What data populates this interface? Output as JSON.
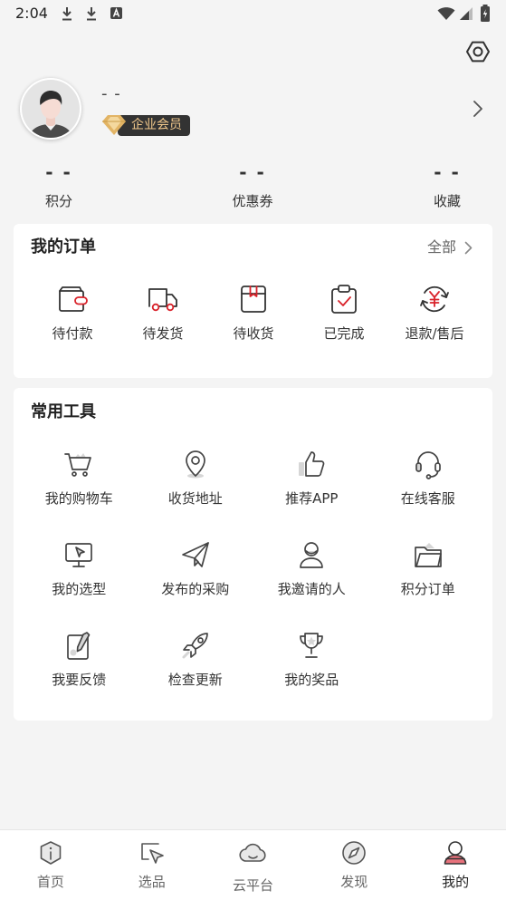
{
  "status_bar": {
    "time": "2:04",
    "left_icons": [
      "download-icon",
      "download-icon",
      "a-badge-icon"
    ],
    "right_icons": [
      "wifi-icon",
      "signal-icon",
      "battery-icon"
    ]
  },
  "header": {
    "settings_icon": "settings-icon"
  },
  "profile": {
    "name": "- -",
    "badge": "企业会员",
    "badge_icon": "diamond-icon",
    "avatar_icon": "avatar-icon",
    "chevron_icon": "chevron-right-icon"
  },
  "stats": [
    {
      "value": "- -",
      "label": "积分"
    },
    {
      "value": "- -",
      "label": "优惠券"
    },
    {
      "value": "- -",
      "label": "收藏"
    }
  ],
  "orders": {
    "title": "我的订单",
    "all_label": "全部",
    "items": [
      {
        "label": "待付款",
        "icon": "wallet-icon"
      },
      {
        "label": "待发货",
        "icon": "truck-icon"
      },
      {
        "label": "待收货",
        "icon": "package-icon"
      },
      {
        "label": "已完成",
        "icon": "clipboard-check-icon"
      },
      {
        "label": "退款/售后",
        "icon": "refund-icon"
      }
    ]
  },
  "tools": {
    "title": "常用工具",
    "items": [
      {
        "label": "我的购物车",
        "icon": "cart-icon"
      },
      {
        "label": "收货地址",
        "icon": "location-pin-icon"
      },
      {
        "label": "推荐APP",
        "icon": "thumbs-up-icon"
      },
      {
        "label": "在线客服",
        "icon": "headset-icon"
      },
      {
        "label": "我的选型",
        "icon": "monitor-cursor-icon"
      },
      {
        "label": "发布的采购",
        "icon": "paper-plane-icon"
      },
      {
        "label": "我邀请的人",
        "icon": "person-icon"
      },
      {
        "label": "积分订单",
        "icon": "folder-icon"
      },
      {
        "label": "我要反馈",
        "icon": "feedback-notepad-icon"
      },
      {
        "label": "检查更新",
        "icon": "rocket-icon"
      },
      {
        "label": "我的奖品",
        "icon": "trophy-icon"
      }
    ]
  },
  "bottom_nav": {
    "items": [
      {
        "label": "首页",
        "icon": "home-icon",
        "active": false
      },
      {
        "label": "选品",
        "icon": "cursor-select-icon",
        "active": false
      },
      {
        "label": "云平台",
        "icon": "cloud-icon",
        "active": false
      },
      {
        "label": "发现",
        "icon": "compass-icon",
        "active": false
      },
      {
        "label": "我的",
        "icon": "profile-icon",
        "active": true
      }
    ]
  },
  "colors": {
    "accent": "#d9222a",
    "background": "#f4f4f4",
    "card": "#ffffff",
    "text": "#333333",
    "muted": "#666666",
    "badge_bg": "#333333",
    "badge_text": "#f2c98c",
    "gold": "#e2b465"
  }
}
